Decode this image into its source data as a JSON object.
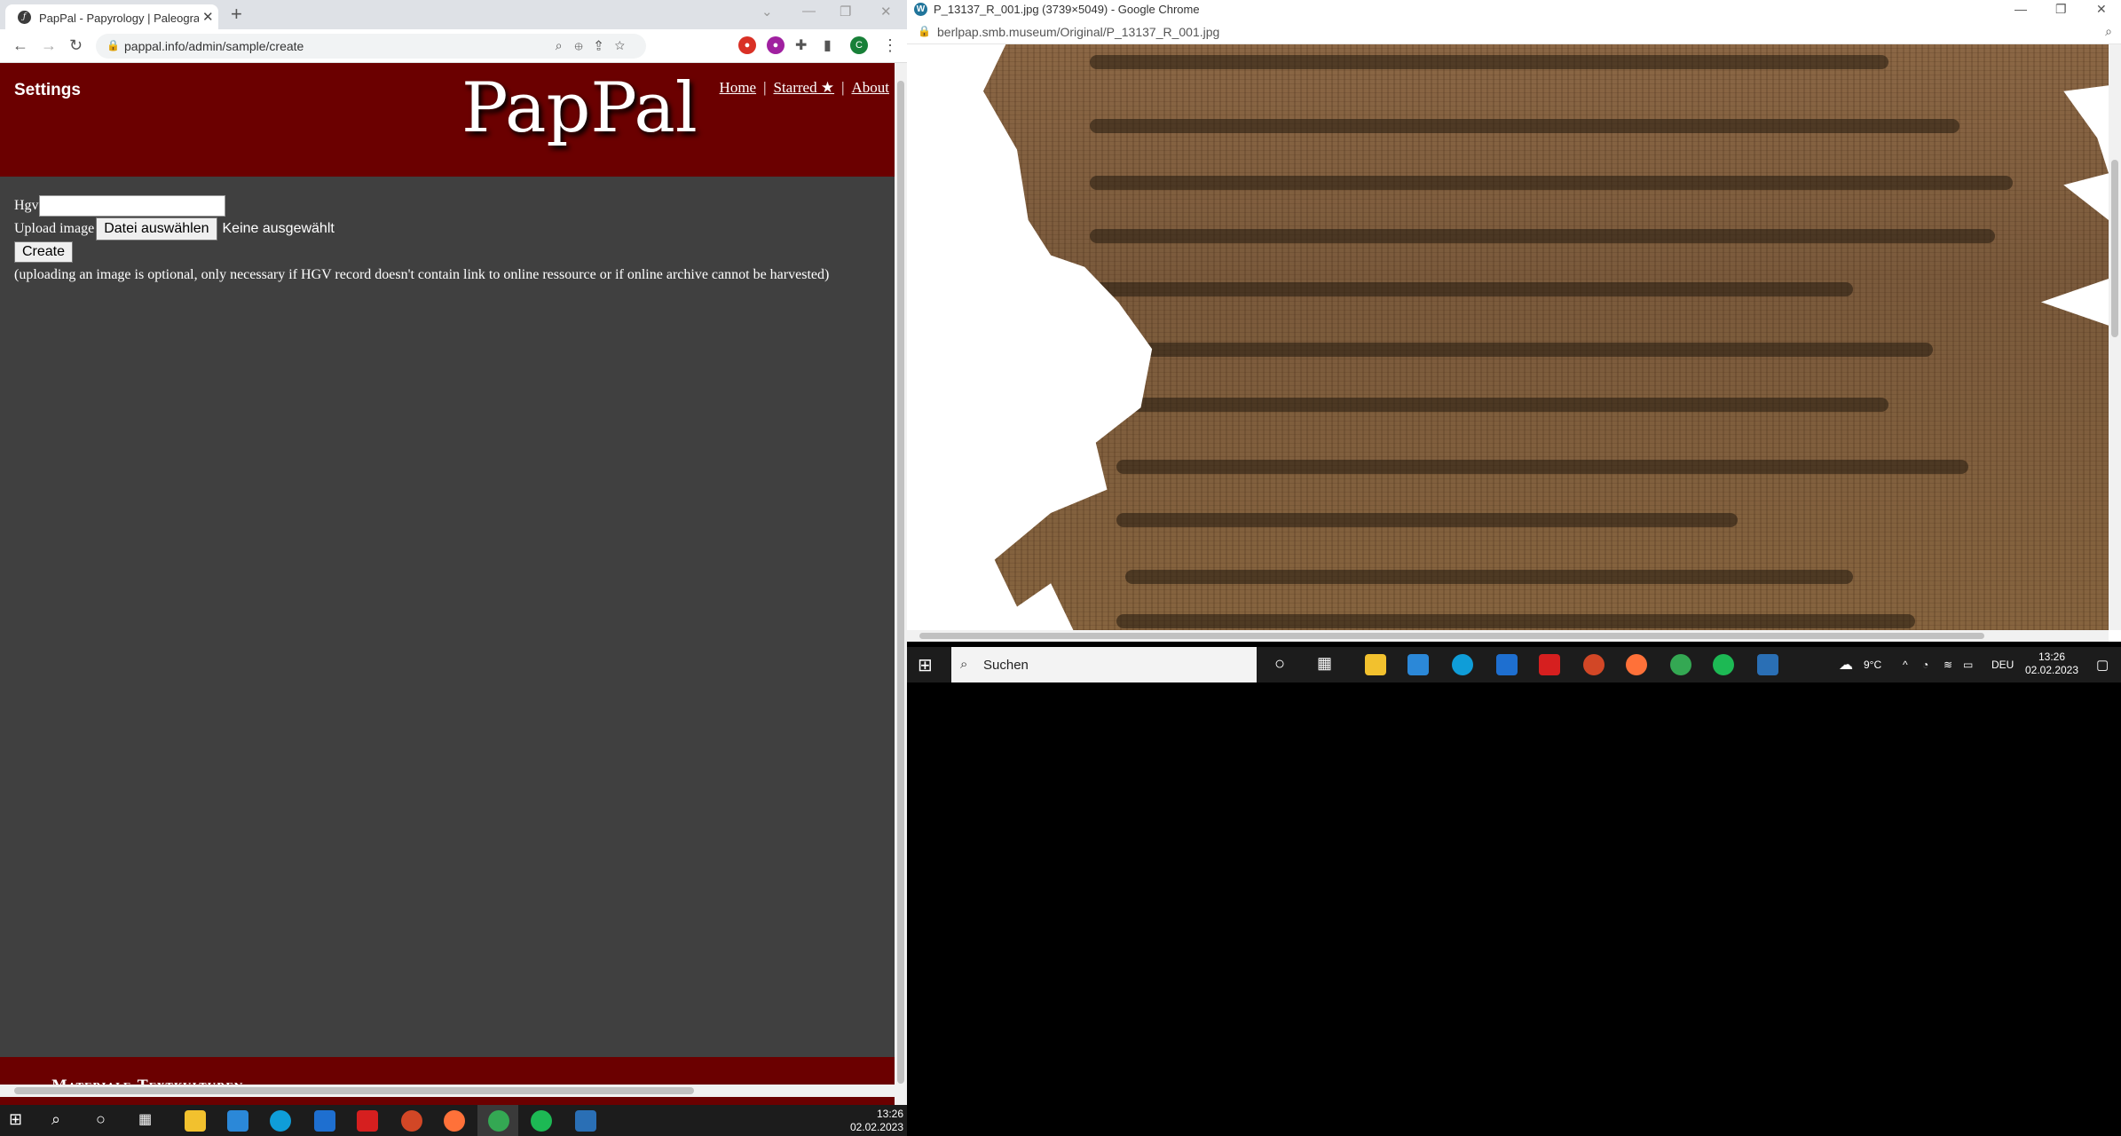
{
  "left_browser": {
    "tab_title": "PapPal - Papyrology | Paleograph",
    "new_tab": "+",
    "url": "pappal.info/admin/sample/create",
    "window_controls": [
      "minimize-icon",
      "restore-icon",
      "close-icon"
    ],
    "extension_avatar": "C"
  },
  "site": {
    "settings": "Settings",
    "logo": "PapPal",
    "nav": {
      "home": "Home",
      "starred": "Starred ★",
      "about": "About",
      "separator": "|"
    },
    "form": {
      "hgv_label": "Hgv",
      "hgv_value": "",
      "upload_label": "Upload image",
      "file_button": "Datei auswählen",
      "file_status": "Keine ausgewählt",
      "create_button": "Create",
      "note": "(uploading an image is optional, only necessary if HGV record doesn't contain link to online ressource or if online archive cannot be harvested)"
    },
    "footer": "Materiale Textkulturen",
    "colors": {
      "header_bg": "#6b0000",
      "page_bg": "#404040"
    }
  },
  "left_taskbar": {
    "time": "13:26",
    "date": "02.02.2023"
  },
  "right_browser": {
    "title": "P_13137_R_001.jpg (3739×5049) - Google Chrome",
    "url": "berlpap.smb.museum/Original/P_13137_R_001.jpg"
  },
  "right_taskbar": {
    "search_placeholder": "Suchen",
    "weather": "9°C",
    "language": "DEU",
    "time": "13:26",
    "date": "02.02.2023"
  }
}
